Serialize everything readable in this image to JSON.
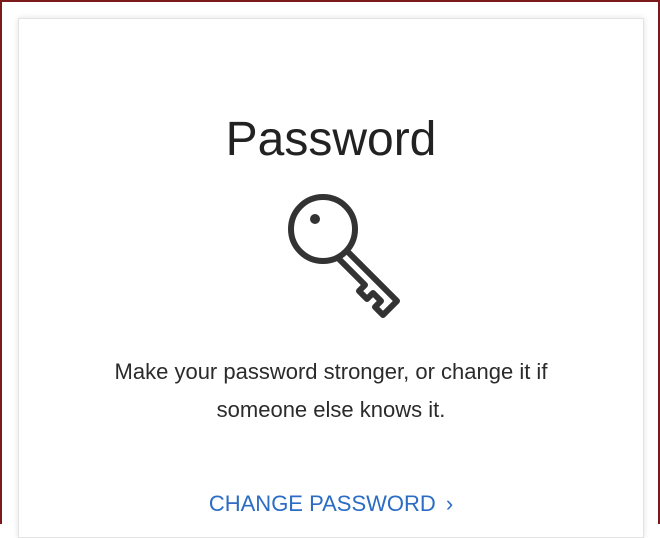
{
  "card": {
    "title": "Password",
    "icon": "key-icon",
    "description_line1": "Make your password stronger, or change it if",
    "description_line2": "someone else knows it.",
    "action_label": "CHANGE PASSWORD",
    "action_chevron": "›"
  },
  "colors": {
    "frame_border": "#7a1a1a",
    "title_text": "#222222",
    "link_text": "#2b6cc4",
    "icon_stroke": "#333333"
  }
}
